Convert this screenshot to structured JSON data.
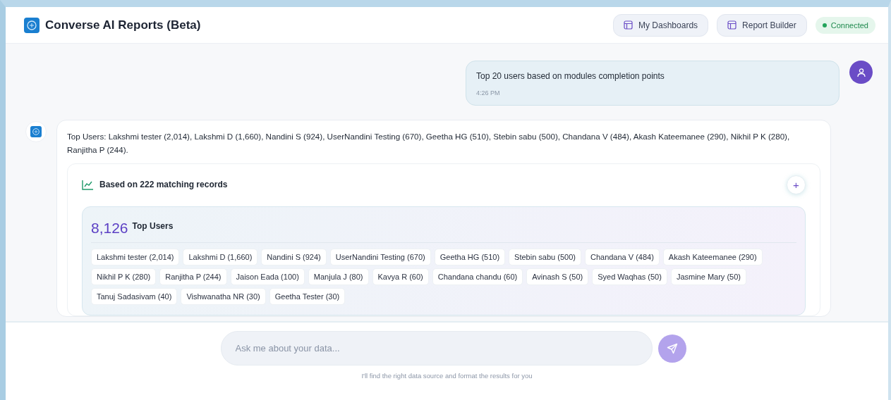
{
  "app": {
    "title": "Converse AI Reports (Beta)"
  },
  "header_buttons": [
    {
      "label": "My Dashboards"
    },
    {
      "label": "Report Builder"
    }
  ],
  "status": {
    "label": "Connected",
    "connected": true
  },
  "messages": [
    {
      "kind": "user",
      "text": "Top 20 users based on modules completion points",
      "time": "4:26 PM"
    },
    {
      "kind": "bot",
      "text": "Top Users: Lakshmi tester (2,014), Lakshmi D (1,660), Nandini S (924), UserNandini Testing (670), Geetha HG (510), Stebin sabu (500), Chandana V (484), Akash Kateemanee (290), Nikhil P K (280), Ranjitha P (244).",
      "result": {
        "caption": "Based on 222 matching records",
        "add_label": "+",
        "value": "8,126",
        "metric": "Top Users",
        "chips": [
          "Lakshmi tester (2,014)",
          "Lakshmi D (1,660)",
          "Nandini S (924)",
          "UserNandini Testing (670)",
          "Geetha HG (510)",
          "Stebin sabu (500)",
          "Chandana V (484)",
          "Akash Kateemanee (290)",
          "Nikhil P K (280)",
          "Ranjitha P (244)",
          "Jaison Eada (100)",
          "Manjula J (80)",
          "Kavya R (60)",
          "Chandana chandu (60)",
          "Avinash S (50)",
          "Syed Waqhas (50)",
          "Jasmine Mary (50)",
          "Tanuj Sadasivam (40)",
          "Vishwanatha NR (30)",
          "Geetha Tester (30)"
        ]
      }
    }
  ],
  "composer": {
    "placeholder": "Ask me about your data...",
    "hint": "I'll find the right data source and format the results for you"
  }
}
